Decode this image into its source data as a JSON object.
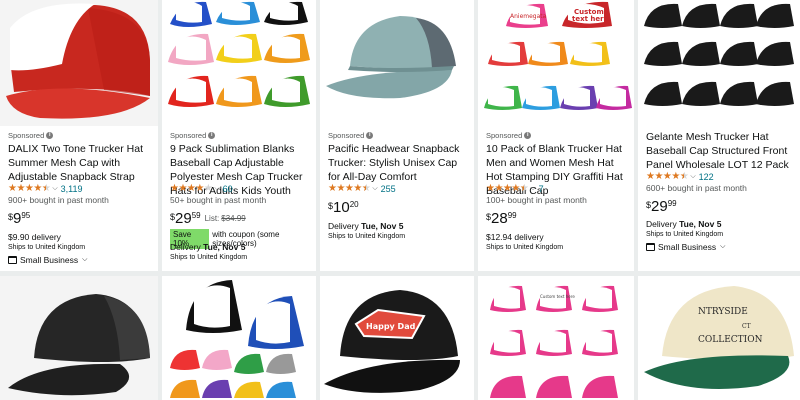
{
  "sponsored_label": "Sponsored",
  "info_glyph": "i",
  "products": [
    {
      "sponsored": true,
      "title": "DALIX Two Tone Trucker Hat Summer Mesh Cap with Adjustable Snapback Strap",
      "rating": 4.5,
      "stars": "★★★★",
      "review_count": "3,119",
      "bought": "900+ bought in past month",
      "price_symbol": "$",
      "price_whole": "9",
      "price_fraction": "95",
      "delivery_fee": "$9.90 delivery",
      "ships": "Ships to United Kingdom",
      "small_business": "Small Business"
    },
    {
      "sponsored": true,
      "title": "9 Pack Sublimation Blanks Baseball Cap Adjustable Polyester Mesh Cap Trucker Hats for Adults Kids Youth",
      "rating": 4.0,
      "stars": "★★★★",
      "review_count": "60",
      "bought": "50+ bought in past month",
      "price_symbol": "$",
      "price_whole": "29",
      "price_fraction": "59",
      "list_label": "List:",
      "list_price": "$34.99",
      "coupon_badge": "Save 10%",
      "coupon_text": "with coupon (some sizes/colors)",
      "delivery_label": "Delivery",
      "delivery_date": "Tue, Nov 5",
      "ships": "Ships to United Kingdom"
    },
    {
      "sponsored": true,
      "title": "Pacific Headwear Snapback Trucker: Stylish Unisex Cap for All-Day Comfort",
      "rating": 4.5,
      "stars": "★★★★",
      "review_count": "255",
      "price_symbol": "$",
      "price_whole": "10",
      "price_fraction": "20",
      "delivery_label": "Delivery",
      "delivery_date": "Tue, Nov 5",
      "ships": "Ships to United Kingdom"
    },
    {
      "sponsored": true,
      "title": "10 Pack of Blank Trucker Hat Men and Women Mesh Hat Hot Stamping DIY Graffiti Hat Baseball Cap",
      "rating": 4.5,
      "stars": "★★★★",
      "review_count": "7",
      "bought": "100+ bought in past month",
      "price_symbol": "$",
      "price_whole": "28",
      "price_fraction": "99",
      "delivery_fee": "$12.94 delivery",
      "ships": "Ships to United Kingdom",
      "image_text": [
        "Aniemegata",
        "Custom",
        "text here"
      ]
    },
    {
      "sponsored": false,
      "title": "Gelante Mesh Trucker Hat Baseball Cap Structured Front Panel Wholesale LOT 12 Pack",
      "rating": 4.5,
      "stars": "★★★★",
      "review_count": "122",
      "bought": "600+ bought in past month",
      "price_symbol": "$",
      "price_whole": "29",
      "price_fraction": "99",
      "delivery_label": "Delivery",
      "delivery_date": "Tue, Nov 5",
      "ships": "Ships to United Kingdom",
      "small_business": "Small Business"
    }
  ],
  "row2": [
    {
      "image": "black-trucker-cap"
    },
    {
      "image": "multicolor-trucker-caps"
    },
    {
      "image": "black-cap-happy-dad-patch",
      "patch_text": "Happy Dad"
    },
    {
      "image": "pink-trucker-caps-pack",
      "patch_text": "Custom text here"
    },
    {
      "image": "cream-green-cap-embroidered",
      "patch_text": [
        "NTRYSIDE",
        "CT",
        "COLLECTION"
      ]
    }
  ],
  "colors": {
    "star": "#de7921",
    "link": "#007185",
    "coupon": "#7fda69",
    "muted": "#565959"
  }
}
